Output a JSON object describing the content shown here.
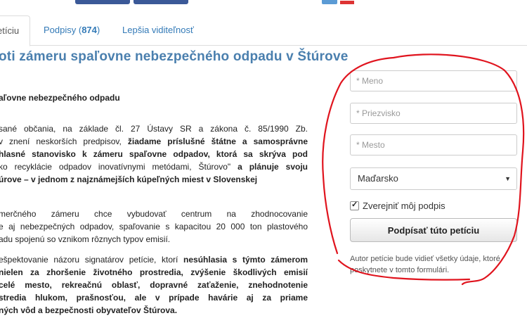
{
  "tabs": [
    {
      "label": "etíciu"
    },
    {
      "label_prefix": "Podpisy (",
      "count": "874",
      "label_suffix": ")"
    },
    {
      "label": "Lepšia viditeľnosť"
    }
  ],
  "title": "oti zámeru spaľovne nebezpečného odpadu v Štúrove",
  "subhead": "aľovne nebezpečného odpadu",
  "para1": [
    {
      "t": "sané občania, na základe čl. 27 Ústavy SR a zákona č. 85/1990 Zb."
    },
    {
      "t": "v znení neskorších predpisov, ",
      "b": "žiadame príslušné štátne a samosprávne"
    },
    {
      "b": "hlasné stanovisko k zámeru spaľovne odpadov, ktorá sa skrýva pod"
    },
    {
      "t": "ko recyklácie odpadov inovatívnymi metódami, Štúrovo\" ",
      "b": "a plánuje svoju"
    },
    {
      "b": "úrove – v jednom z najznámejších kúpeľných miest v Slovenskej"
    }
  ],
  "para2": [
    "merčného zámeru chce vybudovať centrum na zhodnocovanie",
    "e aj nebezpečných odpadov, spaľovanie  s kapacitou 20 000 ton plastového",
    "adu spojenú so vznikom rôznych typov emisií."
  ],
  "para3": [
    {
      "t": "ešpektovanie názoru signatárov petície, ktorí ",
      "b": "nesúhlasia s týmto zámerom"
    },
    {
      "b": "nielen za zhoršenie životného prostredia, zvýšenie škodlivých emisií"
    },
    {
      "b": "celé mesto, rekreačnú oblasť, dopravné zaťaženie, znehodnotenie"
    },
    {
      "b": "stredia hlukom, prašnosťou, ale v prípade havárie aj za priame"
    },
    {
      "b": "ných vôd a bezpečnosti obyvateľov Štúrova."
    }
  ],
  "form": {
    "first_name_placeholder": "* Meno",
    "last_name_placeholder": "* Priezvisko",
    "city_placeholder": "* Mesto",
    "country_value": "Maďarsko",
    "publish_label": "Zverejniť môj podpis",
    "publish_checked": true,
    "submit_label": "Podpísať túto petíciu",
    "note": "Autor petície bude vidieť všetky údaje, ktoré poskytnete v tomto formulári."
  },
  "colors": {
    "link": "#337ab7",
    "title": "#4a7fae",
    "scribble": "#e0141e",
    "facebook": "#3b5998"
  }
}
